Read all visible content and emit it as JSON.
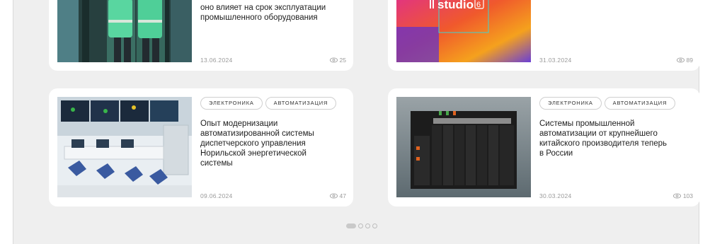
{
  "cards": {
    "top_left": {
      "title_lines": [
        "оно влияет на срок эксплуатации",
        "промышленного оборудования"
      ],
      "date": "13.06.2024",
      "views": "25",
      "image": "industrial-workers-photo"
    },
    "top_right": {
      "date": "31.03.2024",
      "views": "89",
      "image": "studio-6-banner",
      "brand_text": "studio",
      "brand_number": "6"
    },
    "bottom_left": {
      "tags": [
        "ЭЛЕКТРОНИКА",
        "АВТОМАТИЗАЦИЯ"
      ],
      "title_lines": [
        "Опыт модернизации",
        "автоматизированной системы",
        "диспетчерского управления",
        "Норильской энергетической системы"
      ],
      "date": "09.06.2024",
      "views": "47",
      "image": "control-room-illustration"
    },
    "bottom_right": {
      "tags": [
        "ЭЛЕКТРОНИКА",
        "АВТОМАТИЗАЦИЯ"
      ],
      "title_lines": [
        "Системы промышленной",
        "автоматизации от крупнейшего",
        "китайского производителя теперь",
        "в России"
      ],
      "date": "30.03.2024",
      "views": "103",
      "image": "plc-module-rack-photo"
    }
  },
  "pagination": {
    "active_index": 0,
    "count": 4
  },
  "colors": {
    "background": "#efefef",
    "card": "#ffffff",
    "text": "#1d1d1d",
    "muted": "#9a9a9a"
  }
}
